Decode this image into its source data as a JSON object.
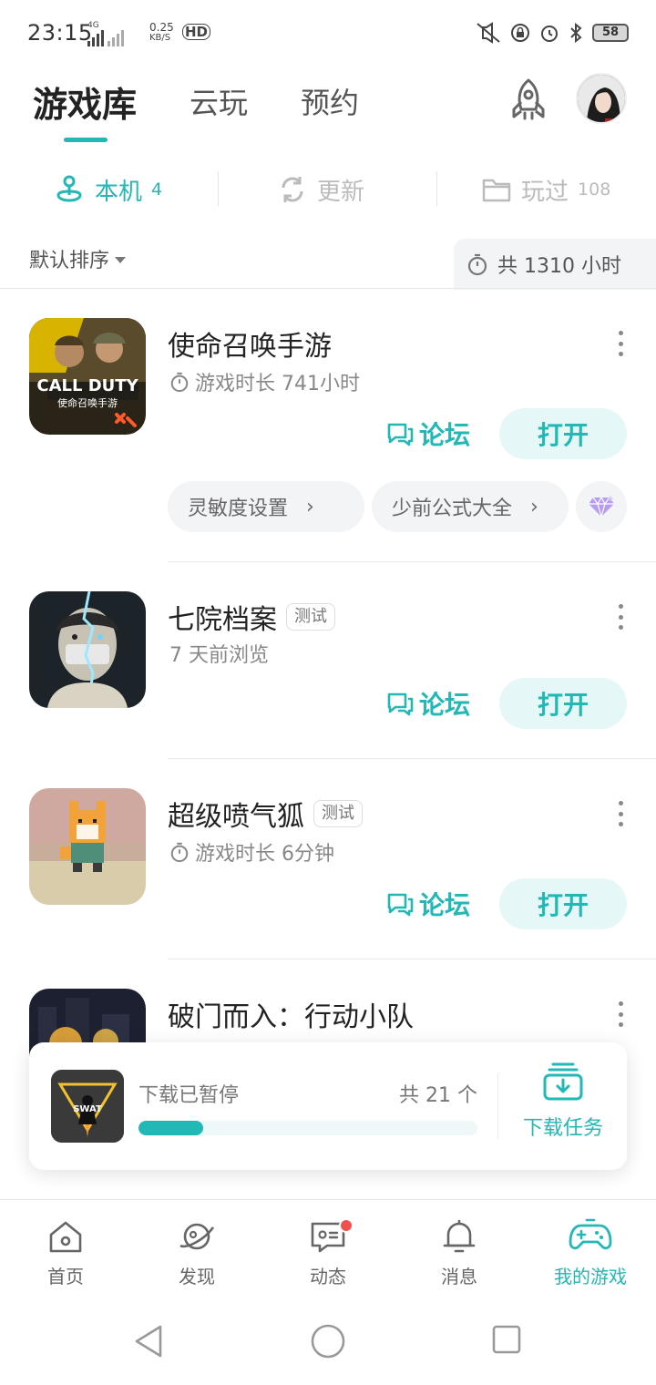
{
  "status_bar": {
    "time": "23:15",
    "network": "4G",
    "speed_value": "0.25",
    "speed_unit": "KB/S",
    "hd": "HD",
    "battery": "58"
  },
  "header": {
    "tabs": [
      {
        "label": "游戏库",
        "active": true
      },
      {
        "label": "云玩",
        "active": false
      },
      {
        "label": "预约",
        "active": false
      }
    ]
  },
  "sub_tabs": [
    {
      "label": "本机",
      "count": "4",
      "icon": "joystick-icon",
      "active": true
    },
    {
      "label": "更新",
      "count": "",
      "icon": "refresh-icon",
      "active": false
    },
    {
      "label": "玩过",
      "count": "108",
      "icon": "folder-icon",
      "active": false
    }
  ],
  "sort": {
    "label": "默认排序",
    "total": "共 1310 小时"
  },
  "games": [
    {
      "title": "使命召唤手游",
      "tag": "",
      "subtitle": "游戏时长 741小时",
      "has_timer": true,
      "forum_label": "论坛",
      "open_label": "打开",
      "chips": [
        "灵敏度设置",
        "少前公式大全"
      ]
    },
    {
      "title": "七院档案",
      "tag": "测试",
      "subtitle": "7 天前浏览",
      "has_timer": false,
      "forum_label": "论坛",
      "open_label": "打开"
    },
    {
      "title": "超级喷气狐",
      "tag": "测试",
      "subtitle": "游戏时长 6分钟",
      "has_timer": true,
      "forum_label": "论坛",
      "open_label": "打开"
    },
    {
      "title": "破门而入：行动小队",
      "tag": "",
      "subtitle": "",
      "has_timer": true
    }
  ],
  "download": {
    "status": "下载已暂停",
    "count": "共 21 个",
    "progress": 0.19,
    "task_label": "下载任务"
  },
  "bottom_nav": [
    {
      "label": "首页",
      "icon": "home-icon",
      "active": false
    },
    {
      "label": "发现",
      "icon": "planet-icon",
      "active": false
    },
    {
      "label": "动态",
      "icon": "chat-icon",
      "active": false,
      "badge": true
    },
    {
      "label": "消息",
      "icon": "bell-icon",
      "active": false
    },
    {
      "label": "我的游戏",
      "icon": "gamepad-icon",
      "active": true
    }
  ],
  "colors": {
    "accent": "#21b8b5",
    "accent_light": "#e6f7f7",
    "badge": "#f15050"
  }
}
